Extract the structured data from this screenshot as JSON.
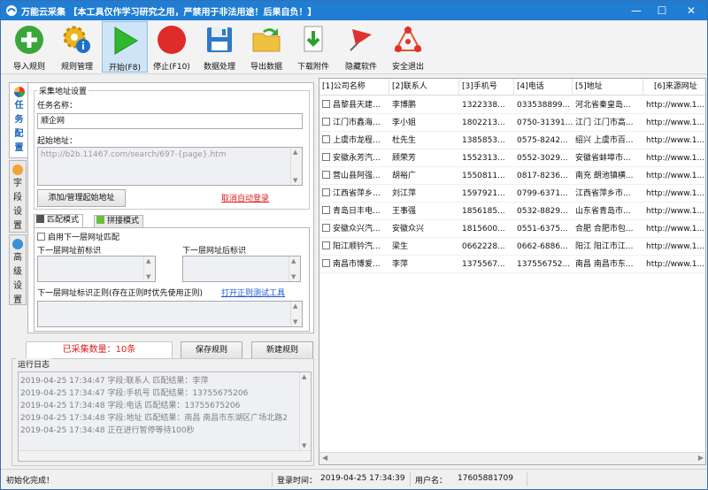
{
  "window": {
    "title": "万能云采集 【本工具仅作学习研究之用，严禁用于非法用途！后果自负！】",
    "minimize": "—",
    "maximize": "☐",
    "close": "✕"
  },
  "toolbar": [
    {
      "label": "导入规则",
      "icon": "add-icon"
    },
    {
      "label": "规则管理",
      "icon": "gear-info-icon"
    },
    {
      "label": "开始(F8)",
      "icon": "play-icon"
    },
    {
      "label": "停止(F10)",
      "icon": "stop-icon"
    },
    {
      "label": "数据处理",
      "icon": "floppy-icon"
    },
    {
      "label": "导出数据",
      "icon": "folder-export-icon"
    },
    {
      "label": "下载附件",
      "icon": "download-icon"
    },
    {
      "label": "隐藏软件",
      "icon": "flag-icon"
    },
    {
      "label": "安全退出",
      "icon": "exit-icon"
    }
  ],
  "side_tabs": [
    {
      "label": "任务配置",
      "icon": "colorball-icon"
    },
    {
      "label": "字段设置",
      "icon": "field-icon"
    },
    {
      "label": "高级设置",
      "icon": "share-icon"
    }
  ],
  "collect": {
    "group_title": "采集地址设置",
    "task_name_label": "任务名称：",
    "task_name_value": "顺企网",
    "start_url_label": "起始地址：",
    "start_url_value": "http://b2b.11467.com/search/697-{page}.htm",
    "add_start_button": "添加/管理起始地址",
    "cancel_login_link": "取消自动登录"
  },
  "match": {
    "tab_match": "匹配模式",
    "tab_concat": "拼接模式",
    "enable_label": "启用下一层网址匹配",
    "prev_label": "下一层网址前标识",
    "next_label": "下一层网址后标识",
    "regex_label": "下一层网址标识正则(存在正则时优先使用正则)",
    "regex_test_link": "打开正则测试工具"
  },
  "actions": {
    "count_text": "已采集数量：10条",
    "save_rule": "保存规则",
    "new_rule": "新建规则"
  },
  "log": {
    "title": "运行日志",
    "lines": [
      "2019-04-25 17:34:47 字段:联系人 匹配结果：李萍",
      "2019-04-25 17:34:47 字段:手机号 匹配结果：13755675206",
      "2019-04-25 17:34:48 字段:电话 匹配结果：13755675206",
      "2019-04-25 17:34:48 字段:地址 匹配结果：南昌 南昌市东湖区广场北路2",
      "2019-04-25 17:34:48 正在进行暂停等待100秒"
    ]
  },
  "grid": {
    "columns": [
      "[1]公司名称",
      "[2]联系人",
      "[3]手机号",
      "[4]电话",
      "[5]地址",
      "[6]来源网址"
    ],
    "rows": [
      [
        "昌黎县天建...",
        "李博鹏",
        "1322338...",
        "033538899...",
        "河北省秦皇岛...",
        "http://www.1..."
      ],
      [
        "江门市鑫海...",
        "李小姐",
        "1802213...",
        "0750-31391...",
        "江门 江门市高...",
        "http://www.1..."
      ],
      [
        "上虞市龙程...",
        "杜先生",
        "1385853...",
        "0575-8242...",
        "绍兴 上虞市百...",
        "http://www.1..."
      ],
      [
        "安徽永芳汽...",
        "顾荣芳",
        "1552313...",
        "0552-3029...",
        "安徽省蚌埠市...",
        "http://www.1..."
      ],
      [
        "营山县阿强...",
        "胡裕广",
        "1550811...",
        "0817-8236...",
        "南充 朗池镇横...",
        "http://www.1..."
      ],
      [
        "江西省萍乡...",
        "刘江萍",
        "1597921...",
        "0799-6371...",
        "江西省萍乡市...",
        "http://www.1..."
      ],
      [
        "青岛日丰电...",
        "王事强",
        "1856185...",
        "0532-8829...",
        "山东省青岛市...",
        "http://www.1..."
      ],
      [
        "安徽众兴汽...",
        "安徽众兴",
        "1815600...",
        "0551-6375...",
        "合肥 合肥市包...",
        "http://www.1..."
      ],
      [
        "阳江顺钤汽...",
        "梁生",
        "0662228...",
        "0662-6886...",
        "阳江 阳江市江...",
        "http://www.1..."
      ],
      [
        "南昌市博爱...",
        "李萍",
        "1375567...",
        "137556752...",
        "南昌 南昌市东...",
        "http://www.1..."
      ]
    ]
  },
  "status": {
    "left": "初始化完成！",
    "login_label": "登录时间：",
    "login_time": "2019-04-25 17:34:39",
    "user_label": "用户名：",
    "user_value": "17605881709"
  }
}
